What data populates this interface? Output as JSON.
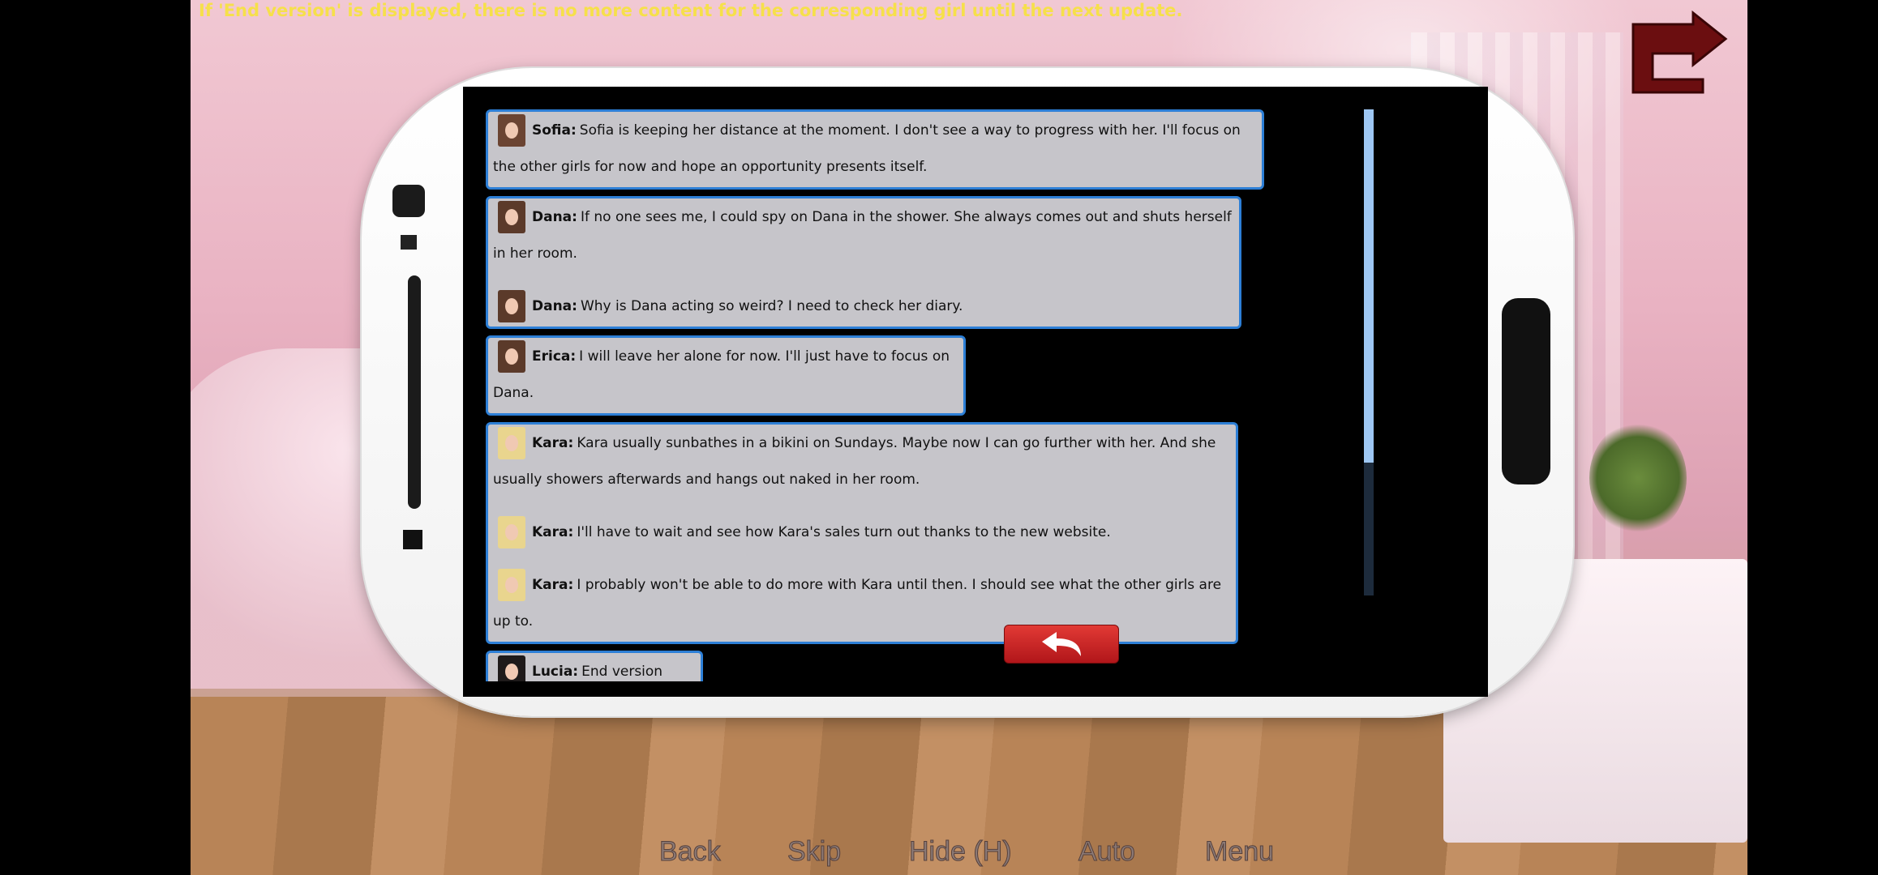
{
  "notice": "If 'End version' is displayed, there is no more content for the corresponding girl until the next update.",
  "icons": {
    "exit": "exit-arrow-icon",
    "back": "return-arrow-icon"
  },
  "colors": {
    "notice": "#f6e04a",
    "card_border": "#2d7fd6",
    "card_bg": "#c6c5ca",
    "back_button": "#d12a2a",
    "scroll_thumb": "#9ec7f3"
  },
  "hints": [
    {
      "messages": [
        {
          "girl": "Sofia:",
          "avatar": "dark",
          "text": "Sofia is keeping her distance at the moment. I don't see a way to progress with her. I'll focus on the other girls for now and hope an opportunity presents itself."
        }
      ]
    },
    {
      "messages": [
        {
          "girl": "Dana:",
          "avatar": "brunette",
          "text": "If no one sees me, I could spy on Dana in the shower. She always comes out and shuts herself in her room."
        },
        {
          "girl": "Dana:",
          "avatar": "brunette",
          "text": "Why is Dana acting so weird? I need to check her diary."
        }
      ]
    },
    {
      "messages": [
        {
          "girl": "Erica:",
          "avatar": "brunette",
          "text": "I will leave her alone for now. I'll just have to focus on Dana."
        }
      ]
    },
    {
      "messages": [
        {
          "girl": "Kara:",
          "avatar": "blond",
          "text": "Kara usually sunbathes in a bikini on Sundays. Maybe now I can go further with her. And she usually showers afterwards and hangs out naked in her room."
        },
        {
          "girl": "Kara:",
          "avatar": "blond",
          "text": "I'll have to wait and see how Kara's sales turn out thanks to the new website."
        },
        {
          "girl": "Kara:",
          "avatar": "blond",
          "text": "I probably won't be able to do more with Kara until then. I should see what the other girls are up to."
        }
      ]
    },
    {
      "messages": [
        {
          "girl": "Lucia:",
          "avatar": "black",
          "text": "End version Lucia."
        }
      ]
    }
  ],
  "scrollbar": {
    "position": 0.0,
    "visible_fraction": 0.73
  },
  "quick_menu": [
    "Back",
    "Skip",
    "Hide (H)",
    "Auto",
    "Menu"
  ]
}
